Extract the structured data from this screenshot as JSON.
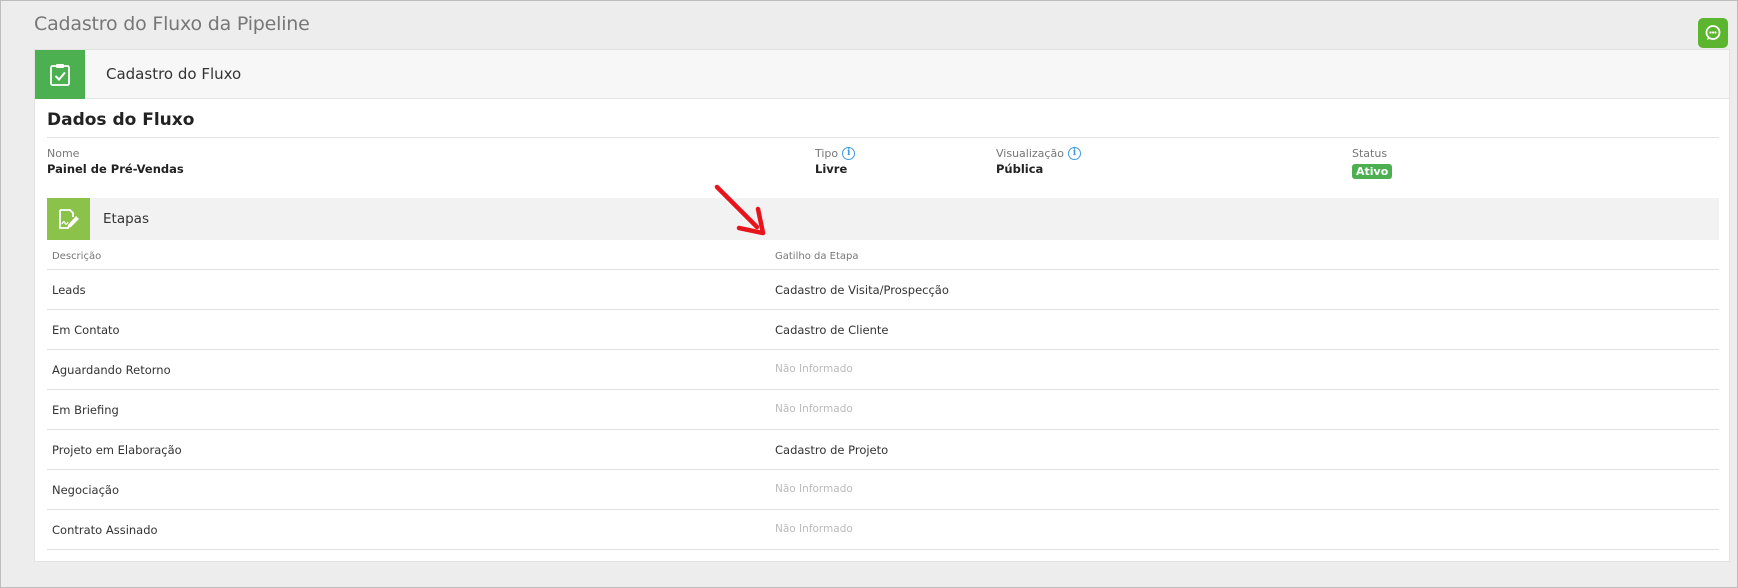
{
  "page": {
    "title": "Cadastro do Fluxo da Pipeline"
  },
  "panel": {
    "header_title": "Cadastro do Fluxo",
    "icon": "clipboard-check-icon"
  },
  "dados": {
    "title": "Dados do Fluxo",
    "nome": {
      "label": "Nome",
      "value": "Painel de Pré-Vendas"
    },
    "tipo": {
      "label": "Tipo",
      "value": "Livre"
    },
    "visualizacao": {
      "label": "Visualização",
      "value": "Pública"
    },
    "status": {
      "label": "Status",
      "value": "Ativo"
    }
  },
  "etapas": {
    "title": "Etapas",
    "icon": "document-edit-icon",
    "columns": {
      "descricao": "Descrição",
      "gatilho": "Gatilho da Etapa"
    },
    "rows": [
      {
        "descricao": "Leads",
        "gatilho": "Cadastro de Visita/Prospecção",
        "muted": false
      },
      {
        "descricao": "Em Contato",
        "gatilho": "Cadastro de Cliente",
        "muted": false
      },
      {
        "descricao": "Aguardando Retorno",
        "gatilho": "Não Informado",
        "muted": true
      },
      {
        "descricao": "Em Briefing",
        "gatilho": "Não Informado",
        "muted": true
      },
      {
        "descricao": "Projeto em Elaboração",
        "gatilho": "Cadastro de Projeto",
        "muted": false
      },
      {
        "descricao": "Negociação",
        "gatilho": "Não Informado",
        "muted": true
      },
      {
        "descricao": "Contrato Assinado",
        "gatilho": "Não Informado",
        "muted": true
      }
    ]
  },
  "colors": {
    "green": "#4caf50",
    "light_green": "#8bc34a",
    "info_blue": "#3d9be0",
    "arrow_red": "#e8141b"
  }
}
